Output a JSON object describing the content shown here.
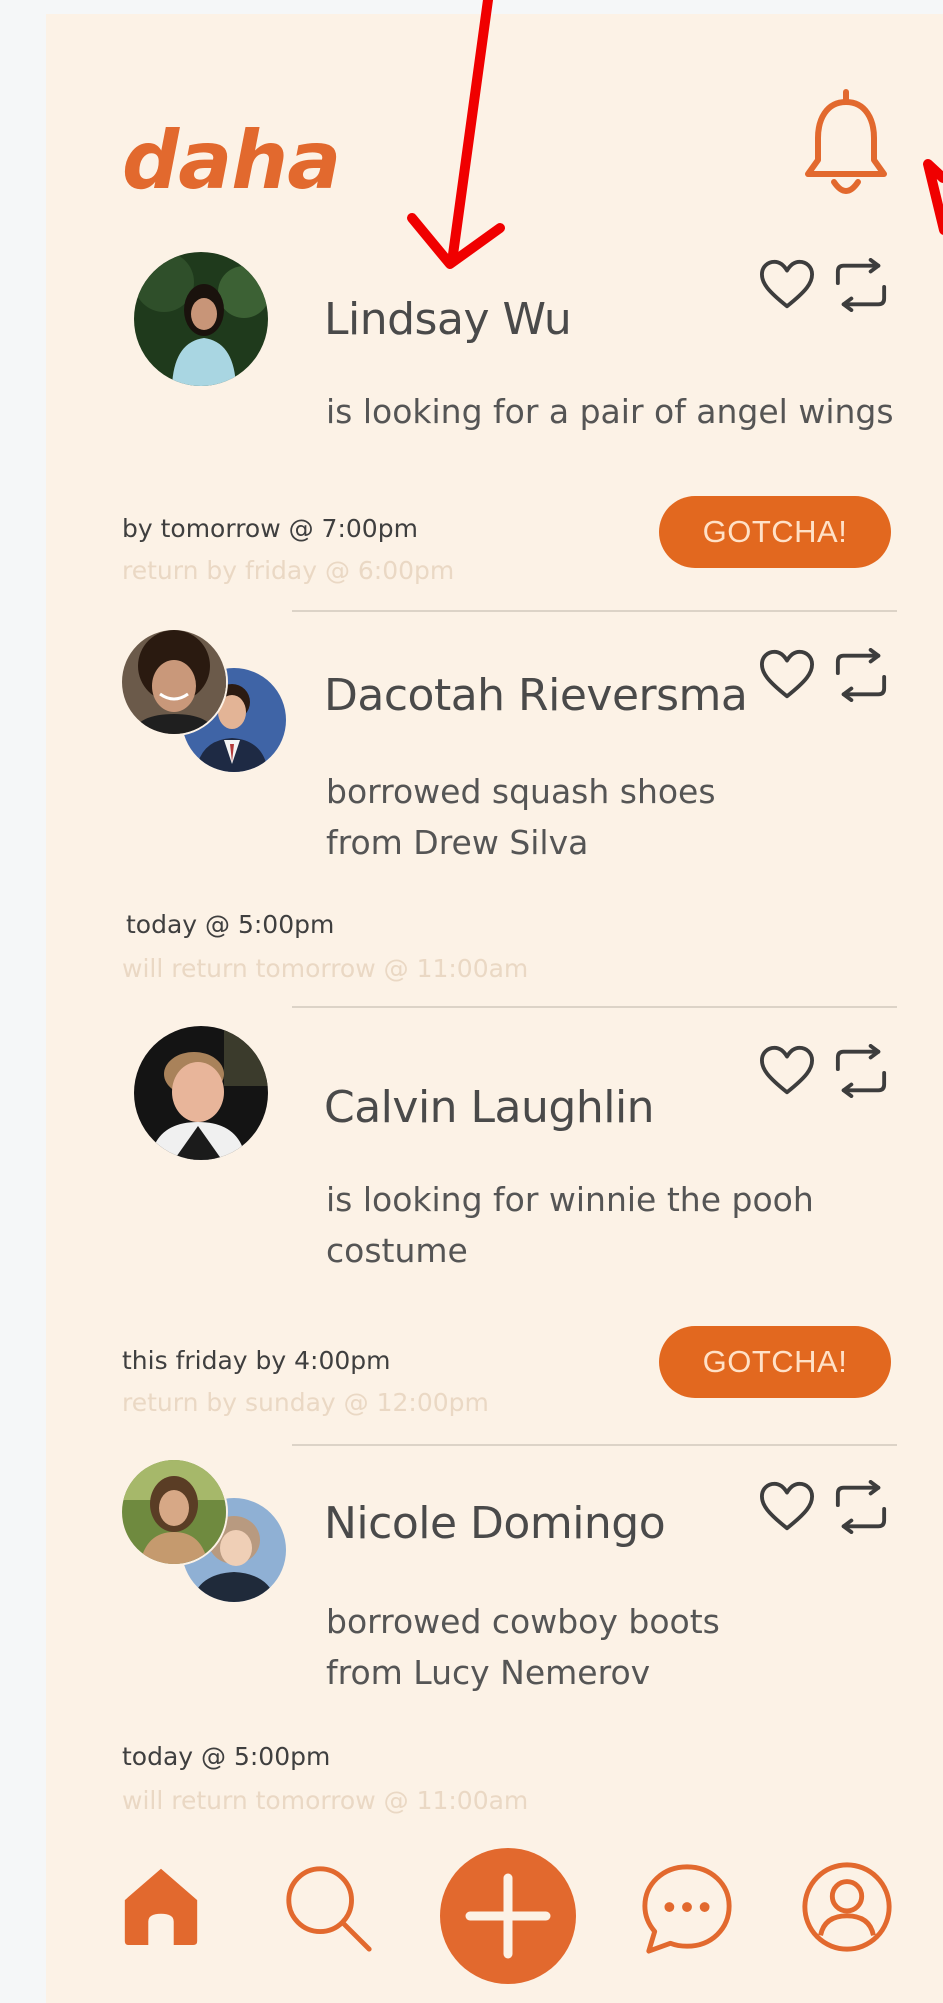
{
  "app": {
    "logo": "daha"
  },
  "posts": [
    {
      "name": "Lindsay Wu",
      "desc": "is looking for a pair of angel wings",
      "when": "by tomorrow @ 7:00pm",
      "ret": "return by friday @ 6:00pm",
      "action": "GOTCHA!"
    },
    {
      "name": "Dacotah Rieversma",
      "desc_line1": "borrowed squash shoes",
      "desc_line2": "from Drew Silva",
      "when": "today @ 5:00pm",
      "ret": "will return tomorrow @ 11:00am"
    },
    {
      "name": "Calvin Laughlin",
      "desc_line1": "is looking for winnie the pooh",
      "desc_line2": "costume",
      "when": "this friday by 4:00pm",
      "ret": "return by sunday @ 12:00pm",
      "action": "GOTCHA!"
    },
    {
      "name": "Nicole Domingo",
      "desc_line1": "borrowed cowboy boots",
      "desc_line2": "from Lucy Nemerov",
      "when": "today @ 5:00pm",
      "ret": "will return tomorrow @ 11:00am"
    }
  ],
  "nav": {
    "items": [
      "home-icon",
      "search-icon",
      "plus-icon",
      "chat-icon",
      "profile-icon"
    ]
  },
  "colors": {
    "accent": "#e2692e",
    "background": "#fcf2e6",
    "annotation": "#f00000"
  }
}
